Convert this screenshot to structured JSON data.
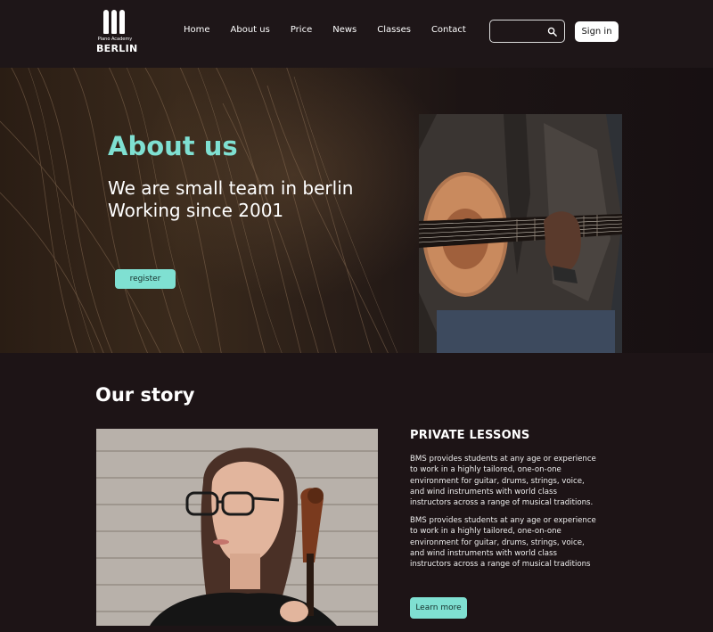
{
  "brand": {
    "subtitle": "Piano Academy",
    "name": "BERLIN"
  },
  "nav": [
    "Home",
    "About us",
    "Price",
    "News",
    "Classes",
    "Contact"
  ],
  "search": {
    "placeholder": "",
    "icon": "search-icon"
  },
  "header": {
    "signin_label": "Sign in"
  },
  "hero": {
    "title": "About us",
    "subtitle_line1": "We are small team in berlin",
    "subtitle_line2": "Working since 2001",
    "register_label": "register"
  },
  "story": {
    "title": "Our story",
    "lessons_title": "PRIVATE LESSONS",
    "paragraph1": "BMS provides students at any age or experience to work in a highly tailored, one-on-one environment for guitar, drums, strings, voice, and wind instruments with world class instructors across a range of musical traditions.",
    "paragraph2": "BMS provides students at any age or experience to work in a highly tailored, one-on-one environment for guitar, drums, strings, voice, and wind instruments with world class instructors across a range of musical traditions",
    "learn_more_label": "Learn more"
  },
  "colors": {
    "accent": "#7fe0d2",
    "background": "#1d1416",
    "header": "#1e1618"
  }
}
